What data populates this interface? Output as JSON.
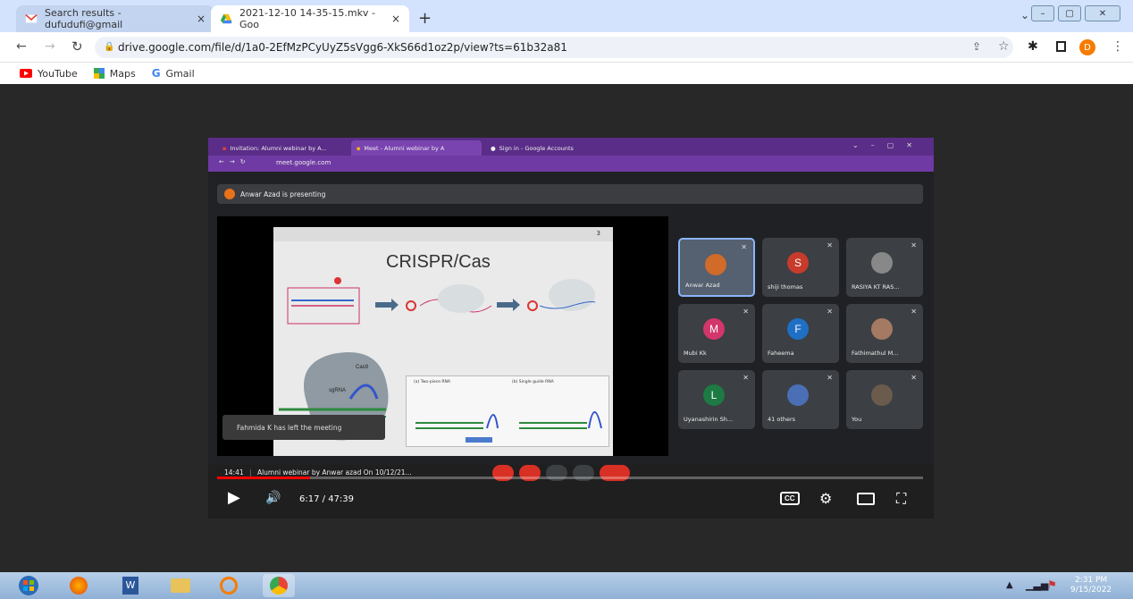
{
  "browser": {
    "tabs": [
      {
        "title": "Search results - dufudufi@gmail"
      },
      {
        "title": "2021-12-10 14-35-15.mkv - Goo"
      }
    ],
    "new_tab_label": "+",
    "close_label": "×",
    "url": "drive.google.com/file/d/1a0-2EfMzPCyUyZ5sVgg6-XkS66d1oz2p/view?ts=61b32a81",
    "profile_initial": "D",
    "bookmarks": [
      {
        "label": "YouTube"
      },
      {
        "label": "Maps"
      },
      {
        "label": "Gmail"
      }
    ]
  },
  "recording": {
    "inner_tabs": [
      {
        "title": "Invitation: Alumni webinar by A..."
      },
      {
        "title": "Meet - Alumni webinar by A"
      },
      {
        "title": "Sign in - Google Accounts"
      }
    ],
    "inner_url": "meet.google.com",
    "presenting_text": "Anwar Azad is presenting",
    "slide": {
      "title": "CRISPR/Cas",
      "page_number": "3",
      "labels": {
        "cas9": "Cas9",
        "sgrna": "sgRNA",
        "two_piece": "(a) Two-piece RNA",
        "single_guide": "(b) Single guide RNA"
      }
    },
    "toast_text": "Fahmida K has left the meeting",
    "participants": [
      {
        "name": "Anwar Azad",
        "initial": "",
        "color": "#d06b2a"
      },
      {
        "name": "shiji thomas",
        "initial": "S",
        "color": "#c63b2b"
      },
      {
        "name": "RASIYA KT RAS...",
        "initial": "",
        "color": "#888888"
      },
      {
        "name": "Mubi Kk",
        "initial": "M",
        "color": "#d3366a"
      },
      {
        "name": "Faheema",
        "initial": "F",
        "color": "#1f6fc4"
      },
      {
        "name": "Fathimathul M...",
        "initial": "",
        "color": "#a47a62"
      },
      {
        "name": "Uyanashirin Sh...",
        "initial": "L",
        "color": "#1d7a43"
      },
      {
        "name": "41 others",
        "initial": "",
        "color": "#4a6fb5"
      },
      {
        "name": "You",
        "initial": "",
        "color": "#6a5b4d"
      }
    ],
    "meet_time": "14:41",
    "meet_title": "Alumni webinar by Anwar azad On 10/12/21..."
  },
  "player": {
    "time_current": "6:17",
    "time_total": "47:39",
    "progress_fraction": 0.132,
    "cc_label": "CC"
  },
  "taskbar": {
    "clock_time": "2:31 PM",
    "clock_date": "9/15/2022"
  }
}
